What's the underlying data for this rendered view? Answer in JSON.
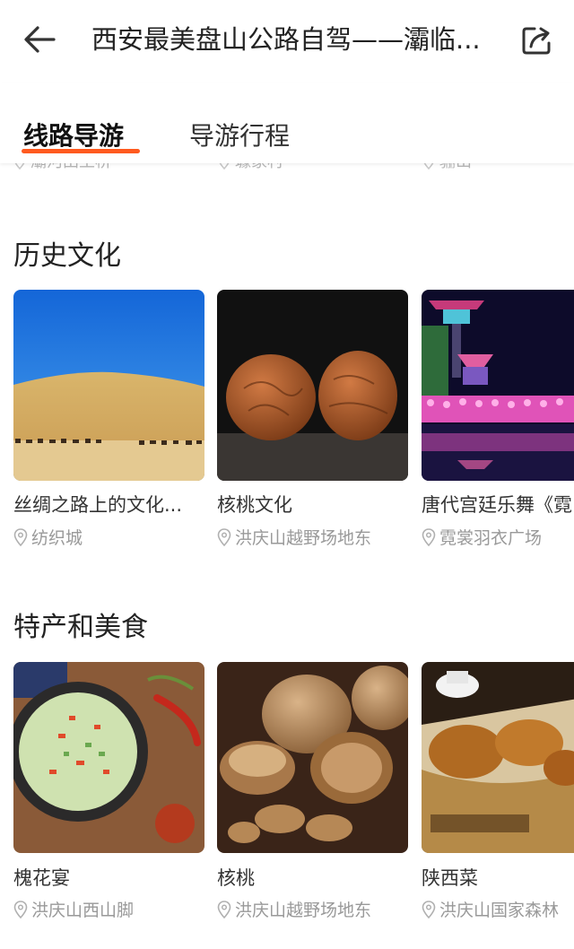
{
  "header": {
    "title": "西安最美盘山公路自驾——灞临...",
    "back_icon": "back-arrow-icon",
    "share_icon": "share-icon"
  },
  "tabs": [
    {
      "label": "线路导游",
      "active": true
    },
    {
      "label": "导游行程",
      "active": false
    }
  ],
  "accent_color": "#ff5a1f",
  "previous_row_locations": [
    "灞河田王桥",
    "璩家村",
    "骊山"
  ],
  "sections": [
    {
      "title": "历史文化",
      "cards": [
        {
          "name": "丝绸之路上的文化...",
          "location": "纺织城"
        },
        {
          "name": "核桃文化",
          "location": "洪庆山越野场地东"
        },
        {
          "name": "唐代宫廷乐舞《霓",
          "location": "霓裳羽衣广场"
        }
      ]
    },
    {
      "title": "特产和美食",
      "cards": [
        {
          "name": "槐花宴",
          "location": "洪庆山西山脚"
        },
        {
          "name": "核桃",
          "location": "洪庆山越野场地东"
        },
        {
          "name": "陕西菜",
          "location": "洪庆山国家森林"
        }
      ]
    }
  ]
}
